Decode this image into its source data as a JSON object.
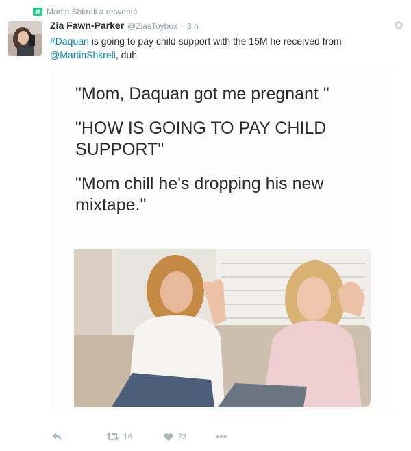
{
  "context": {
    "retweet_icon": "retweet-icon",
    "text": "Martin Shkreli a retweeté"
  },
  "tweet": {
    "author_name": "Zia Fawn-Parker",
    "username": "@ZiasToybox",
    "separator": "·",
    "time": "3 h",
    "text_parts": {
      "hashtag": "#Daquan",
      "middle": " is going to pay child support with the 15M he received from ",
      "mention": "@MartinShkreli",
      "end": ", duh"
    }
  },
  "media": {
    "line1": "\"Mom, Daquan got me pregnant \"",
    "line2": "\"HOW IS GOING TO PAY CHILD SUPPORT\"",
    "line3": "\"Mom chill he's dropping his new mixtape.\""
  },
  "actions": {
    "retweet_count": "16",
    "like_count": "73"
  },
  "colors": {
    "link": "#0084b4",
    "retweet_green": "#19cf86",
    "muted": "#8899a6",
    "action_icon": "#aab8c2"
  }
}
